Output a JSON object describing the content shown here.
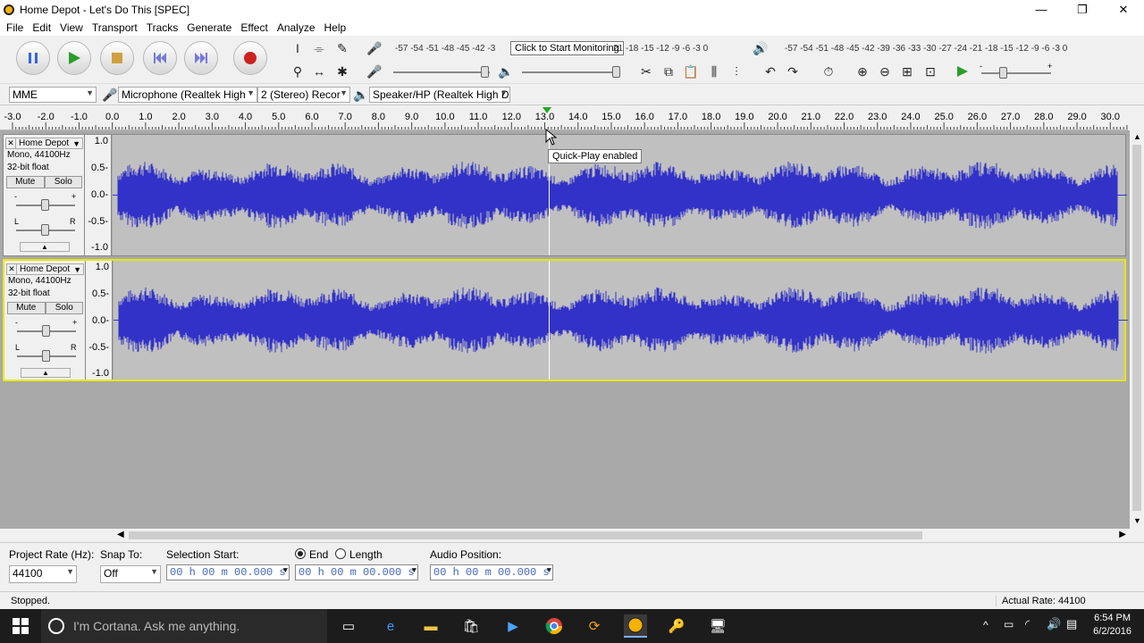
{
  "window": {
    "title": "Home Depot - Let's Do This [SPEC]",
    "minimize": "—",
    "restore": "❐",
    "close": "✕"
  },
  "menu": [
    "File",
    "Edit",
    "View",
    "Transport",
    "Tracks",
    "Generate",
    "Effect",
    "Analyze",
    "Help"
  ],
  "meters": {
    "record_scale": "-57 -54 -51 -48 -45 -42 -3",
    "record_scale_tail": "21 -18 -15 -12 -9 -6 -3 0",
    "monitor_tooltip": "Click to Start Monitoring",
    "play_scale": "-57 -54 -51 -48 -45 -42 -39 -36 -33 -30 -27 -24 -21 -18 -15 -12 -9 -6 -3 0",
    "lr_top": "L",
    "lr_bottom": "R"
  },
  "slider_minus": "-",
  "slider_plus": "+",
  "devices": {
    "host": "MME",
    "input": "Microphone (Realtek High",
    "channels": "2 (Stereo) Recor",
    "output": "Speaker/HP (Realtek High D"
  },
  "ruler": {
    "ticks": [
      "-3.0",
      "-2.0",
      "-1.0",
      "0.0",
      "1.0",
      "2.0",
      "3.0",
      "4.0",
      "5.0",
      "6.0",
      "7.0",
      "8.0",
      "9.0",
      "10.0",
      "11.0",
      "12.0",
      "13.0",
      "14.0",
      "15.0",
      "16.0",
      "17.0",
      "18.0",
      "19.0",
      "20.0",
      "21.0",
      "22.0",
      "23.0",
      "24.0",
      "25.0",
      "26.0",
      "27.0",
      "28.0",
      "29.0",
      "30.0"
    ],
    "tooltip": "Quick-Play enabled"
  },
  "tracks": [
    {
      "name": "Home Depot",
      "line1": "Mono, 44100Hz",
      "line2": "32-bit float",
      "mute": "Mute",
      "solo": "Solo",
      "gain_minus": "-",
      "gain_plus": "+",
      "pan_l": "L",
      "pan_r": "R",
      "scale": [
        "1.0",
        "0.5-",
        "0.0-",
        "-0.5-",
        "-1.0"
      ]
    },
    {
      "name": "Home Depot",
      "line1": "Mono, 44100Hz",
      "line2": "32-bit float",
      "mute": "Mute",
      "solo": "Solo",
      "gain_minus": "-",
      "gain_plus": "+",
      "pan_l": "L",
      "pan_r": "R",
      "scale": [
        "1.0",
        "0.5-",
        "0.0-",
        "-0.5-",
        "-1.0"
      ]
    }
  ],
  "selection": {
    "project_rate_label": "Project Rate (Hz):",
    "project_rate": "44100",
    "snap_label": "Snap To:",
    "snap_value": "Off",
    "sel_start_label": "Selection Start:",
    "end_label": "End",
    "length_label": "Length",
    "audio_pos_label": "Audio Position:",
    "start_time": "00 h 00 m 00.000 s",
    "end_time": "00 h 00 m 00.000 s",
    "audio_pos": "00 h 00 m 00.000 s"
  },
  "status": {
    "left": "Stopped.",
    "right": "Actual Rate: 44100"
  },
  "taskbar": {
    "cortana": "I'm Cortana. Ask me anything.",
    "time": "6:54 PM",
    "date": "6/2/2016"
  },
  "colors": {
    "waveform": "#3232c8",
    "play": "#2a9d2a",
    "record": "#cc2222",
    "pause": "#3366dd"
  }
}
